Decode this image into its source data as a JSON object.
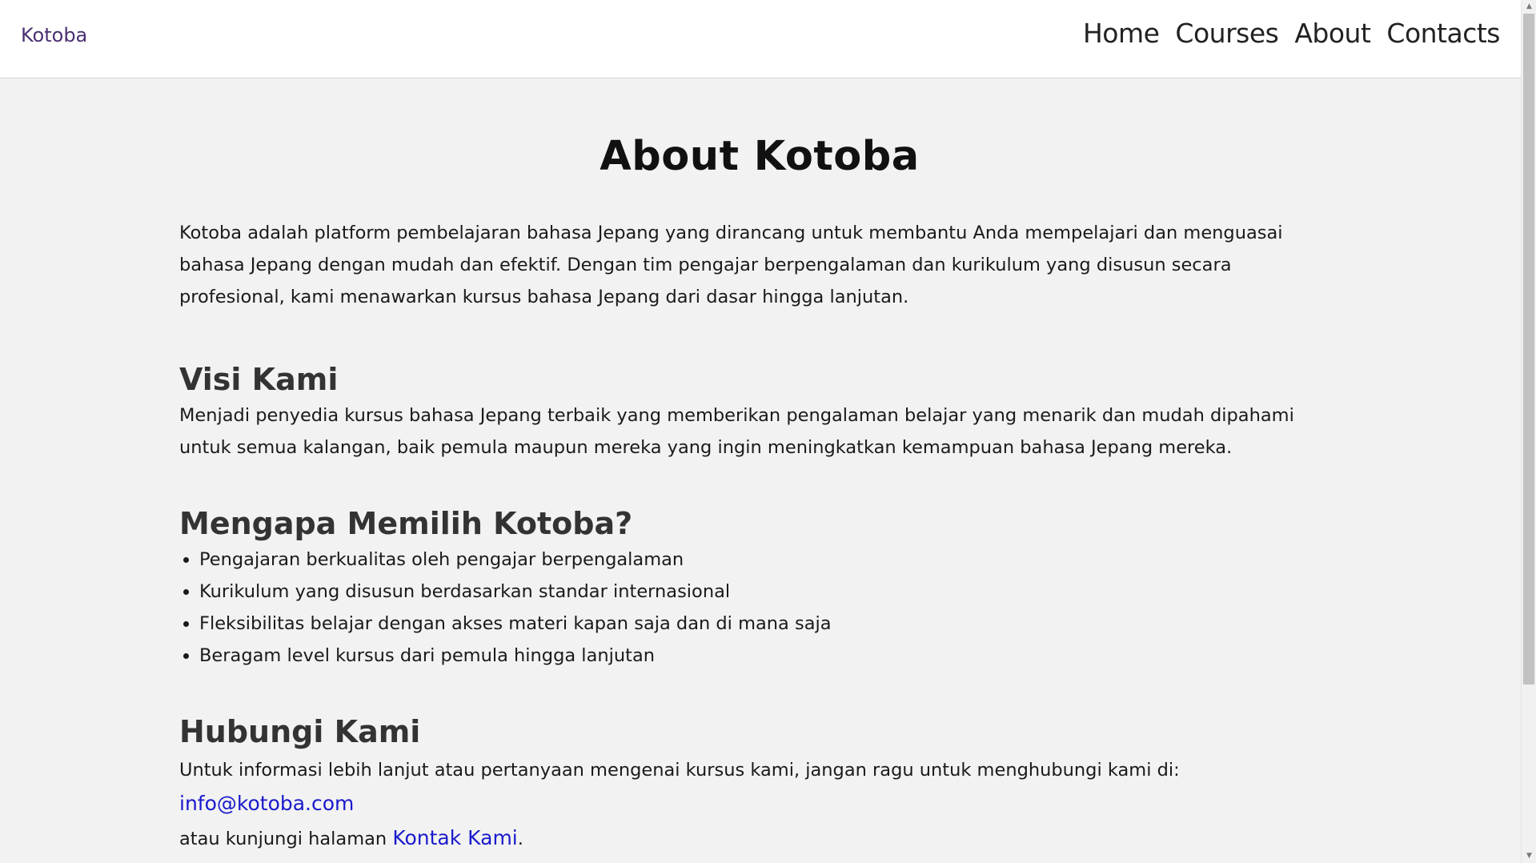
{
  "navbar": {
    "brand": "Kotoba",
    "links": [
      "Home",
      "Courses",
      "About",
      "Contacts"
    ]
  },
  "main": {
    "title": "About Kotoba",
    "intro": "Kotoba adalah platform pembelajaran bahasa Jepang yang dirancang untuk membantu Anda mempelajari dan menguasai bahasa Jepang dengan mudah dan efektif. Dengan tim pengajar berpengalaman dan kurikulum yang disusun secara profesional, kami menawarkan kursus bahasa Jepang dari dasar hingga lanjutan.",
    "visi": {
      "heading": "Visi Kami",
      "text": "Menjadi penyedia kursus bahasa Jepang terbaik yang memberikan pengalaman belajar yang menarik dan mudah dipahami untuk semua kalangan, baik pemula maupun mereka yang ingin meningkatkan kemampuan bahasa Jepang mereka."
    },
    "why": {
      "heading": "Mengapa Memilih Kotoba?",
      "items": [
        "Pengajaran berkualitas oleh pengajar berpengalaman",
        "Kurikulum yang disusun berdasarkan standar internasional",
        "Fleksibilitas belajar dengan akses materi kapan saja dan di mana saja",
        "Beragam level kursus dari pemula hingga lanjutan"
      ]
    },
    "contact": {
      "heading": "Hubungi Kami",
      "text_before": "Untuk informasi lebih lanjut atau pertanyaan mengenai kursus kami, jangan ragu untuk menghubungi kami di: ",
      "email": "info@kotoba.com",
      "text_middle": "atau kunjungi halaman ",
      "contact_link": "Kontak Kami",
      "text_end": "."
    }
  },
  "colors": {
    "brand": "#4b3072",
    "link": "#1a1acc",
    "background": "#f2f2f2"
  }
}
